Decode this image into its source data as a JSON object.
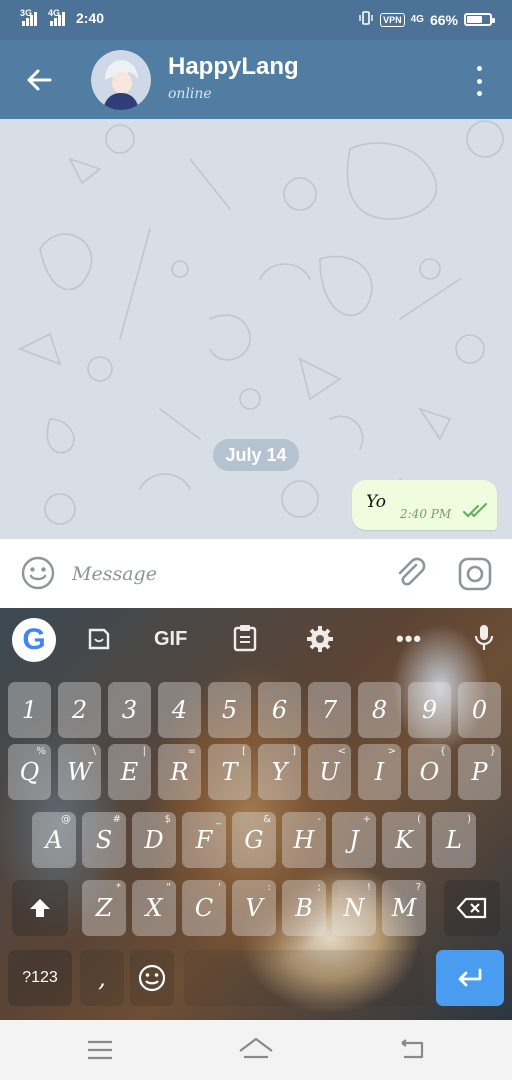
{
  "status_bar": {
    "signal1_label": "3G",
    "signal2_label": "4G",
    "time": "2:40",
    "vpn_label": "VPN",
    "network_label": "4G",
    "battery_text": "66%",
    "battery_level": 0.66
  },
  "header": {
    "name": "HappyLang",
    "status": "online"
  },
  "chat": {
    "date_label": "July 14",
    "messages": [
      {
        "text": "Yo",
        "time": "2:40 PM",
        "status": "read"
      }
    ]
  },
  "input": {
    "placeholder": "Message"
  },
  "keyboard": {
    "gif_label": "GIF",
    "number_row": [
      {
        "main": "1"
      },
      {
        "main": "2"
      },
      {
        "main": "3"
      },
      {
        "main": "4"
      },
      {
        "main": "5"
      },
      {
        "main": "6"
      },
      {
        "main": "7"
      },
      {
        "main": "8"
      },
      {
        "main": "9"
      },
      {
        "main": "0"
      }
    ],
    "row1": [
      {
        "main": "Q",
        "sub": "%"
      },
      {
        "main": "W",
        "sub": "\\"
      },
      {
        "main": "E",
        "sub": "|"
      },
      {
        "main": "R",
        "sub": "="
      },
      {
        "main": "T",
        "sub": "["
      },
      {
        "main": "Y",
        "sub": "]"
      },
      {
        "main": "U",
        "sub": "<"
      },
      {
        "main": "I",
        "sub": ">"
      },
      {
        "main": "O",
        "sub": "{"
      },
      {
        "main": "P",
        "sub": "}"
      }
    ],
    "row2": [
      {
        "main": "A",
        "sub": "@"
      },
      {
        "main": "S",
        "sub": "#"
      },
      {
        "main": "D",
        "sub": "$"
      },
      {
        "main": "F",
        "sub": "_"
      },
      {
        "main": "G",
        "sub": "&"
      },
      {
        "main": "H",
        "sub": "-"
      },
      {
        "main": "J",
        "sub": "+"
      },
      {
        "main": "K",
        "sub": "("
      },
      {
        "main": "L",
        "sub": ")"
      }
    ],
    "row3": [
      {
        "main": "Z",
        "sub": "*"
      },
      {
        "main": "X",
        "sub": "\""
      },
      {
        "main": "C",
        "sub": "'"
      },
      {
        "main": "V",
        "sub": ":"
      },
      {
        "main": "B",
        "sub": ";"
      },
      {
        "main": "N",
        "sub": "!"
      },
      {
        "main": "M",
        "sub": "?"
      }
    ],
    "symbols_label": "?123",
    "comma_label": ","
  }
}
